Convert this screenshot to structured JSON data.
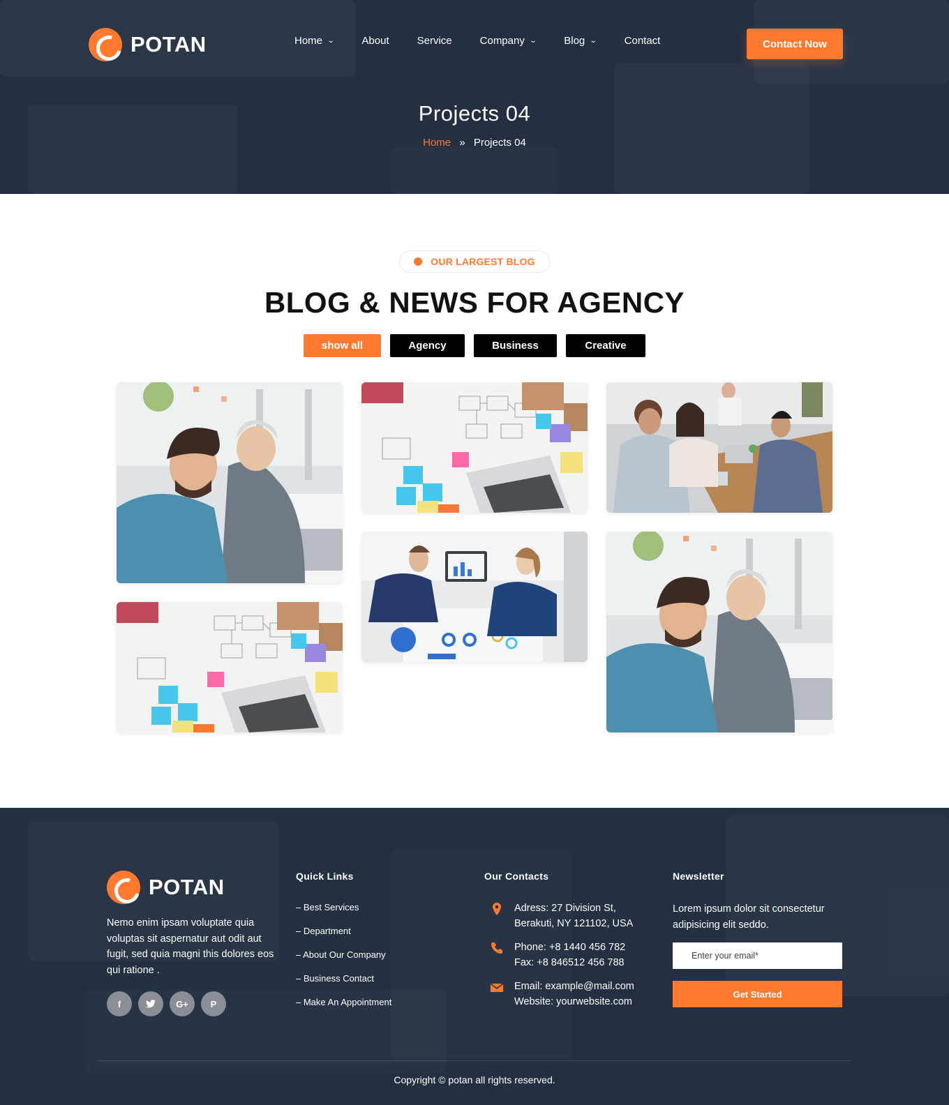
{
  "header": {
    "brand": "POTAN",
    "nav": [
      {
        "label": "Home",
        "dropdown": true
      },
      {
        "label": "About",
        "dropdown": false
      },
      {
        "label": "Service",
        "dropdown": false
      },
      {
        "label": "Company",
        "dropdown": true
      },
      {
        "label": "Blog",
        "dropdown": true
      },
      {
        "label": "Contact",
        "dropdown": false
      }
    ],
    "cta_label": "Contact Now"
  },
  "hero": {
    "title": "Projects 04",
    "breadcrumb": {
      "home": "Home",
      "separator": "»",
      "current": "Projects 04"
    }
  },
  "section": {
    "badge": "OUR LARGEST BLOG",
    "title": "BLOG & NEWS FOR AGENCY",
    "filters": [
      "show all",
      "Agency",
      "Business",
      "Creative"
    ],
    "active_filter": "show all"
  },
  "gallery": [
    {
      "scene": "man-and-woman-discussing"
    },
    {
      "scene": "wireframes-sticky-notes-overhead"
    },
    {
      "scene": "team-working-at-table"
    },
    {
      "scene": "wireframes-sticky-notes-overhead"
    },
    {
      "scene": "two-people-reviewing-charts"
    },
    {
      "scene": "man-and-woman-discussing"
    }
  ],
  "footer": {
    "brand": "POTAN",
    "description": "Nemo enim ipsam voluptate quia voluptas sit aspernatur aut odit aut fugit, sed quia magni this dolores eos qui ratione .",
    "socials": [
      {
        "icon": "facebook-icon",
        "glyph": "f"
      },
      {
        "icon": "twitter-icon",
        "glyph": "t"
      },
      {
        "icon": "google-plus-icon",
        "glyph": "G+"
      },
      {
        "icon": "pinterest-icon",
        "glyph": "P"
      }
    ],
    "quick_links": {
      "heading": "Quick Links",
      "items": [
        "– Best Services",
        "– Department",
        "– About Our Company",
        "– Business Contact",
        "– Make An Appointment"
      ]
    },
    "contacts": {
      "heading": "Our Contacts",
      "address_line1": "Adress: 27 Division St,",
      "address_line2": "Berakuti, NY 121102, USA",
      "phone": "Phone: +8 1440 456 782",
      "fax": "Fax: +8 846512 456 788",
      "email": "Email: example@mail.com",
      "website": "Website: yourwebsite.com"
    },
    "newsletter": {
      "heading": "Newsletter",
      "text": "Lorem ipsum dolor sit consectetur adipisicing elit seddo.",
      "placeholder": "Enter your email*",
      "button": "Get Started"
    },
    "copyright": "Copyright © potan all rights reserved."
  },
  "colors": {
    "accent": "#ff7a2f",
    "dark": "#243042",
    "black": "#000000"
  }
}
